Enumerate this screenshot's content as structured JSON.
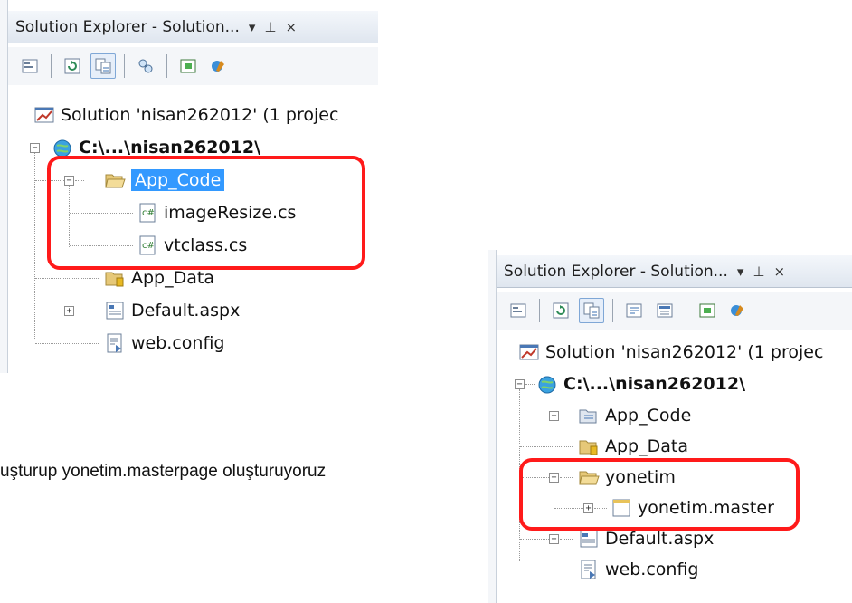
{
  "panel1": {
    "title": "Solution Explorer - Solution...",
    "title_glyphs": {
      "dropdown": "▾",
      "pin": "⊥",
      "close": "×"
    },
    "toolbar_icons": [
      "properties-icon",
      "refresh-icon",
      "show-all-files-icon",
      "copy-website-icon",
      "view-designer-icon",
      "asp-config-icon"
    ],
    "tree": {
      "solution": "Solution 'nisan262012' (1 projec",
      "project": "C:\\...\\nisan262012\\",
      "app_code": "App_Code",
      "file1": "imageResize.cs",
      "file2": "vtclass.cs",
      "app_data": "App_Data",
      "default": "Default.aspx",
      "webconfig": "web.config"
    }
  },
  "panel2": {
    "title": "Solution Explorer - Solution...",
    "title_glyphs": {
      "dropdown": "▾",
      "pin": "⊥",
      "close": "×"
    },
    "tree": {
      "solution": "Solution 'nisan262012' (1 projec",
      "project": "C:\\...\\nisan262012\\",
      "app_code": "App_Code",
      "app_data": "App_Data",
      "yonetim": "yonetim",
      "master": "yonetim.master",
      "default": "Default.aspx",
      "webconfig": "web.config"
    }
  },
  "caption": "uşturup yonetim.masterpage oluşturuyoruz",
  "colors": {
    "selection": "#3399ff",
    "highlight": "#ff1a1a"
  }
}
